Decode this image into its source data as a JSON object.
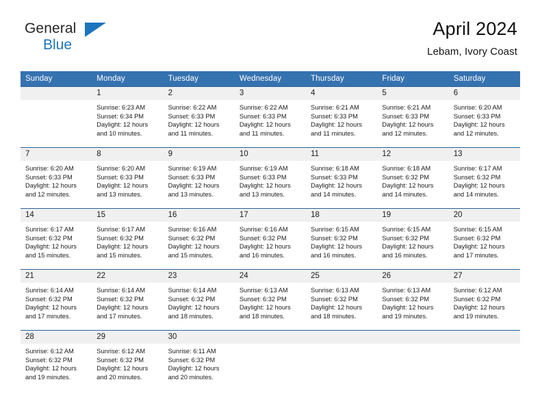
{
  "brand": {
    "name_top": "General",
    "name_bottom": "Blue",
    "accent_color": "#1c75bc"
  },
  "header": {
    "title": "April 2024",
    "subtitle": "Lebam, Ivory Coast"
  },
  "theme": {
    "header_blue": "#3572b0",
    "row_line": "#2a6099",
    "daynum_bg": "#f0f0f0"
  },
  "calendar": {
    "weekday_headers": [
      "Sunday",
      "Monday",
      "Tuesday",
      "Wednesday",
      "Thursday",
      "Friday",
      "Saturday"
    ],
    "weeks": [
      [
        {
          "day": "",
          "empty": true,
          "sunrise": "",
          "sunset": "",
          "daylight_line1": "",
          "daylight_line2": ""
        },
        {
          "day": "1",
          "sunrise": "Sunrise: 6:23 AM",
          "sunset": "Sunset: 6:34 PM",
          "daylight_line1": "Daylight: 12 hours",
          "daylight_line2": "and 10 minutes."
        },
        {
          "day": "2",
          "sunrise": "Sunrise: 6:22 AM",
          "sunset": "Sunset: 6:33 PM",
          "daylight_line1": "Daylight: 12 hours",
          "daylight_line2": "and 11 minutes."
        },
        {
          "day": "3",
          "sunrise": "Sunrise: 6:22 AM",
          "sunset": "Sunset: 6:33 PM",
          "daylight_line1": "Daylight: 12 hours",
          "daylight_line2": "and 11 minutes."
        },
        {
          "day": "4",
          "sunrise": "Sunrise: 6:21 AM",
          "sunset": "Sunset: 6:33 PM",
          "daylight_line1": "Daylight: 12 hours",
          "daylight_line2": "and 11 minutes."
        },
        {
          "day": "5",
          "sunrise": "Sunrise: 6:21 AM",
          "sunset": "Sunset: 6:33 PM",
          "daylight_line1": "Daylight: 12 hours",
          "daylight_line2": "and 12 minutes."
        },
        {
          "day": "6",
          "sunrise": "Sunrise: 6:20 AM",
          "sunset": "Sunset: 6:33 PM",
          "daylight_line1": "Daylight: 12 hours",
          "daylight_line2": "and 12 minutes."
        }
      ],
      [
        {
          "day": "7",
          "sunrise": "Sunrise: 6:20 AM",
          "sunset": "Sunset: 6:33 PM",
          "daylight_line1": "Daylight: 12 hours",
          "daylight_line2": "and 12 minutes."
        },
        {
          "day": "8",
          "sunrise": "Sunrise: 6:20 AM",
          "sunset": "Sunset: 6:33 PM",
          "daylight_line1": "Daylight: 12 hours",
          "daylight_line2": "and 13 minutes."
        },
        {
          "day": "9",
          "sunrise": "Sunrise: 6:19 AM",
          "sunset": "Sunset: 6:33 PM",
          "daylight_line1": "Daylight: 12 hours",
          "daylight_line2": "and 13 minutes."
        },
        {
          "day": "10",
          "sunrise": "Sunrise: 6:19 AM",
          "sunset": "Sunset: 6:33 PM",
          "daylight_line1": "Daylight: 12 hours",
          "daylight_line2": "and 13 minutes."
        },
        {
          "day": "11",
          "sunrise": "Sunrise: 6:18 AM",
          "sunset": "Sunset: 6:33 PM",
          "daylight_line1": "Daylight: 12 hours",
          "daylight_line2": "and 14 minutes."
        },
        {
          "day": "12",
          "sunrise": "Sunrise: 6:18 AM",
          "sunset": "Sunset: 6:32 PM",
          "daylight_line1": "Daylight: 12 hours",
          "daylight_line2": "and 14 minutes."
        },
        {
          "day": "13",
          "sunrise": "Sunrise: 6:17 AM",
          "sunset": "Sunset: 6:32 PM",
          "daylight_line1": "Daylight: 12 hours",
          "daylight_line2": "and 14 minutes."
        }
      ],
      [
        {
          "day": "14",
          "sunrise": "Sunrise: 6:17 AM",
          "sunset": "Sunset: 6:32 PM",
          "daylight_line1": "Daylight: 12 hours",
          "daylight_line2": "and 15 minutes."
        },
        {
          "day": "15",
          "sunrise": "Sunrise: 6:17 AM",
          "sunset": "Sunset: 6:32 PM",
          "daylight_line1": "Daylight: 12 hours",
          "daylight_line2": "and 15 minutes."
        },
        {
          "day": "16",
          "sunrise": "Sunrise: 6:16 AM",
          "sunset": "Sunset: 6:32 PM",
          "daylight_line1": "Daylight: 12 hours",
          "daylight_line2": "and 15 minutes."
        },
        {
          "day": "17",
          "sunrise": "Sunrise: 6:16 AM",
          "sunset": "Sunset: 6:32 PM",
          "daylight_line1": "Daylight: 12 hours",
          "daylight_line2": "and 16 minutes."
        },
        {
          "day": "18",
          "sunrise": "Sunrise: 6:15 AM",
          "sunset": "Sunset: 6:32 PM",
          "daylight_line1": "Daylight: 12 hours",
          "daylight_line2": "and 16 minutes."
        },
        {
          "day": "19",
          "sunrise": "Sunrise: 6:15 AM",
          "sunset": "Sunset: 6:32 PM",
          "daylight_line1": "Daylight: 12 hours",
          "daylight_line2": "and 16 minutes."
        },
        {
          "day": "20",
          "sunrise": "Sunrise: 6:15 AM",
          "sunset": "Sunset: 6:32 PM",
          "daylight_line1": "Daylight: 12 hours",
          "daylight_line2": "and 17 minutes."
        }
      ],
      [
        {
          "day": "21",
          "sunrise": "Sunrise: 6:14 AM",
          "sunset": "Sunset: 6:32 PM",
          "daylight_line1": "Daylight: 12 hours",
          "daylight_line2": "and 17 minutes."
        },
        {
          "day": "22",
          "sunrise": "Sunrise: 6:14 AM",
          "sunset": "Sunset: 6:32 PM",
          "daylight_line1": "Daylight: 12 hours",
          "daylight_line2": "and 17 minutes."
        },
        {
          "day": "23",
          "sunrise": "Sunrise: 6:14 AM",
          "sunset": "Sunset: 6:32 PM",
          "daylight_line1": "Daylight: 12 hours",
          "daylight_line2": "and 18 minutes."
        },
        {
          "day": "24",
          "sunrise": "Sunrise: 6:13 AM",
          "sunset": "Sunset: 6:32 PM",
          "daylight_line1": "Daylight: 12 hours",
          "daylight_line2": "and 18 minutes."
        },
        {
          "day": "25",
          "sunrise": "Sunrise: 6:13 AM",
          "sunset": "Sunset: 6:32 PM",
          "daylight_line1": "Daylight: 12 hours",
          "daylight_line2": "and 18 minutes."
        },
        {
          "day": "26",
          "sunrise": "Sunrise: 6:13 AM",
          "sunset": "Sunset: 6:32 PM",
          "daylight_line1": "Daylight: 12 hours",
          "daylight_line2": "and 19 minutes."
        },
        {
          "day": "27",
          "sunrise": "Sunrise: 6:12 AM",
          "sunset": "Sunset: 6:32 PM",
          "daylight_line1": "Daylight: 12 hours",
          "daylight_line2": "and 19 minutes."
        }
      ],
      [
        {
          "day": "28",
          "sunrise": "Sunrise: 6:12 AM",
          "sunset": "Sunset: 6:32 PM",
          "daylight_line1": "Daylight: 12 hours",
          "daylight_line2": "and 19 minutes."
        },
        {
          "day": "29",
          "sunrise": "Sunrise: 6:12 AM",
          "sunset": "Sunset: 6:32 PM",
          "daylight_line1": "Daylight: 12 hours",
          "daylight_line2": "and 20 minutes."
        },
        {
          "day": "30",
          "sunrise": "Sunrise: 6:11 AM",
          "sunset": "Sunset: 6:32 PM",
          "daylight_line1": "Daylight: 12 hours",
          "daylight_line2": "and 20 minutes."
        },
        {
          "day": "",
          "empty": true,
          "sunrise": "",
          "sunset": "",
          "daylight_line1": "",
          "daylight_line2": ""
        },
        {
          "day": "",
          "empty": true,
          "sunrise": "",
          "sunset": "",
          "daylight_line1": "",
          "daylight_line2": ""
        },
        {
          "day": "",
          "empty": true,
          "sunrise": "",
          "sunset": "",
          "daylight_line1": "",
          "daylight_line2": ""
        },
        {
          "day": "",
          "empty": true,
          "sunrise": "",
          "sunset": "",
          "daylight_line1": "",
          "daylight_line2": ""
        }
      ]
    ]
  }
}
